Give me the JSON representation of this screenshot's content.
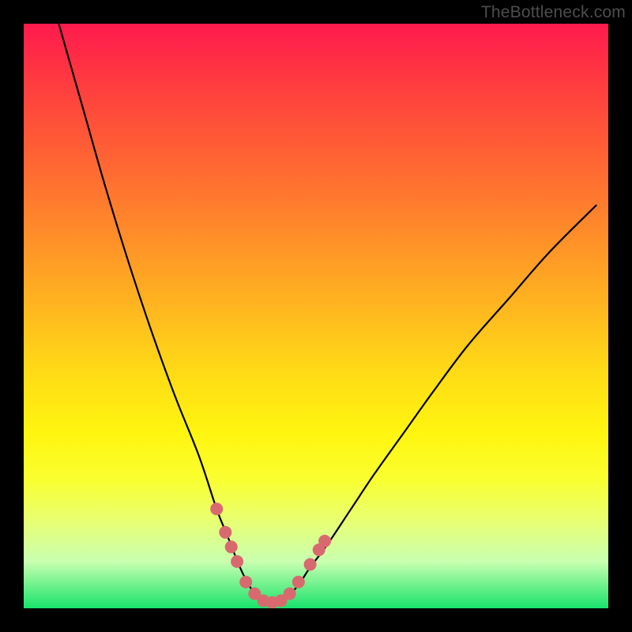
{
  "attribution": "TheBottleneck.com",
  "colors": {
    "page_bg": "#000000",
    "gradient_top": "#ff1a4d",
    "gradient_bottom": "#17e36b",
    "curve": "#000000",
    "marker": "#d86a6f",
    "attribution_text": "#4d4d4d"
  },
  "chart_data": {
    "type": "line",
    "title": "",
    "xlabel": "",
    "ylabel": "",
    "xlim": [
      0,
      100
    ],
    "ylim": [
      0,
      100
    ],
    "grid": false,
    "series": [
      {
        "name": "bottleneck-curve",
        "x": [
          6,
          10,
          14,
          18,
          22,
          26,
          30,
          33,
          35,
          37,
          38.5,
          40,
          41.5,
          43,
          45,
          47,
          49,
          52,
          56,
          60,
          65,
          70,
          76,
          83,
          90,
          98
        ],
        "y": [
          100,
          86,
          72,
          59,
          47,
          36,
          26,
          17,
          12,
          7,
          4,
          2,
          1,
          1,
          2,
          4,
          7,
          11,
          17,
          23,
          30,
          37,
          45,
          53,
          61,
          69
        ]
      }
    ],
    "markers": [
      {
        "x": 33.0,
        "y": 17.0
      },
      {
        "x": 34.5,
        "y": 13.0
      },
      {
        "x": 35.5,
        "y": 10.5
      },
      {
        "x": 36.5,
        "y": 8.0
      },
      {
        "x": 38.0,
        "y": 4.5
      },
      {
        "x": 39.5,
        "y": 2.5
      },
      {
        "x": 41.0,
        "y": 1.3
      },
      {
        "x": 42.5,
        "y": 1.0
      },
      {
        "x": 44.0,
        "y": 1.3
      },
      {
        "x": 45.5,
        "y": 2.5
      },
      {
        "x": 47.0,
        "y": 4.5
      },
      {
        "x": 49.0,
        "y": 7.5
      },
      {
        "x": 50.5,
        "y": 10.0
      },
      {
        "x": 51.5,
        "y": 11.5
      }
    ]
  }
}
